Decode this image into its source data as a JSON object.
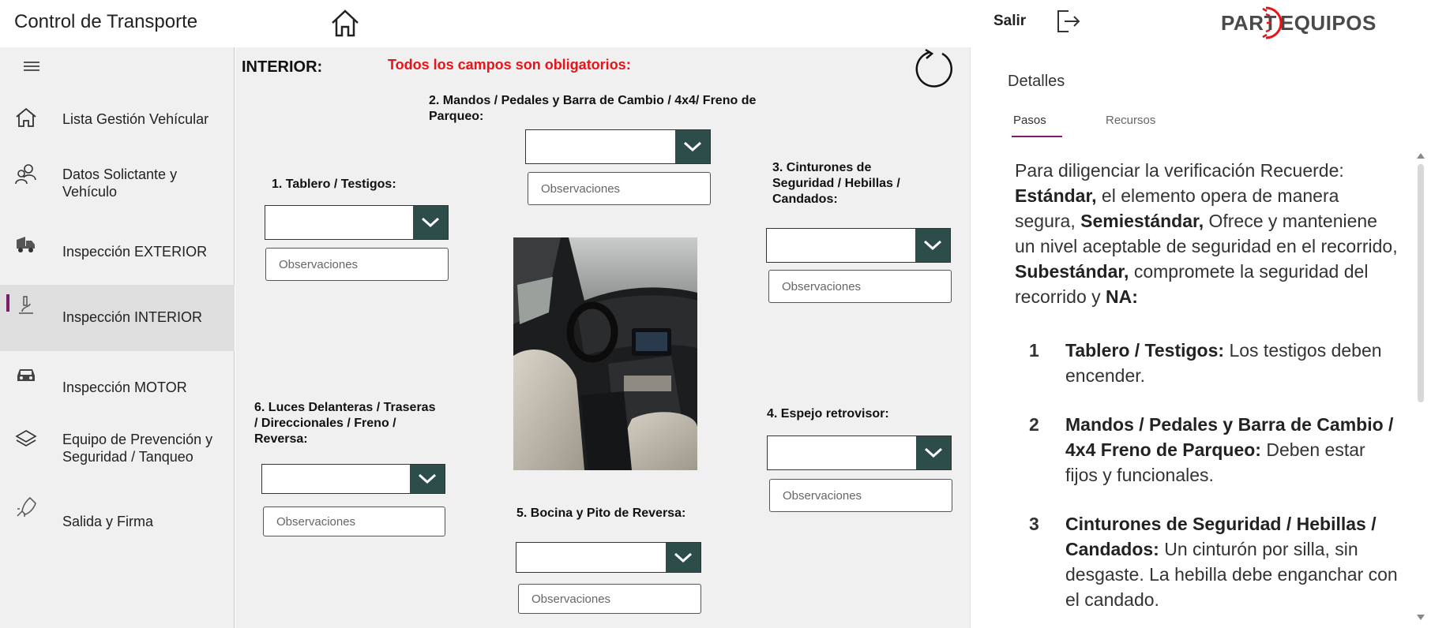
{
  "header": {
    "app_title": "Control de Transporte",
    "exit_label": "Salir",
    "brand_left": "PART",
    "brand_right": "EQUIPOS"
  },
  "sidebar": {
    "items": [
      {
        "label": "Lista  Gestión Vehícular",
        "icon": "home-icon"
      },
      {
        "label": "Datos Solictante y Vehículo",
        "icon": "people-icon"
      },
      {
        "label": "Inspección EXTERIOR",
        "icon": "truck-icon"
      },
      {
        "label": "Inspección INTERIOR",
        "icon": "microscope-icon",
        "active": true
      },
      {
        "label": "Inspección MOTOR",
        "icon": "car-icon"
      },
      {
        "label": "Equipo de Prevención y Seguridad / Tanqueo",
        "icon": "layers-icon"
      },
      {
        "label": "Salida y Firma",
        "icon": "rocket-icon"
      }
    ]
  },
  "main": {
    "section_title": "INTERIOR:",
    "required_note": "Todos los campos son obligatorios:",
    "observation_placeholder": "Observaciones",
    "fields": [
      {
        "label": "1. Tablero / Testigos:"
      },
      {
        "label": "2. Mandos / Pedales y Barra de Cambio / 4x4/ Freno de Parqueo:"
      },
      {
        "label": "3. Cinturones de Seguridad / Hebillas / Candados:"
      },
      {
        "label": "4. Espejo retrovisor:"
      },
      {
        "label": "5. Bocina y Pito de Reversa:"
      },
      {
        "label": "6. Luces Delanteras / Traseras / Direccionales / Freno / Reversa:"
      }
    ]
  },
  "details": {
    "title": "Detalles",
    "tabs": [
      "Pasos",
      "Recursos"
    ],
    "intro": {
      "p1": "Para diligenciar la verificación Recuerde: ",
      "b1": "Estándar,",
      "p2": " el elemento opera de manera segura, ",
      "b2": "Semiestándar,",
      "p3": " Ofrece y manteniene un nivel aceptable de seguridad en el recorrido, ",
      "b3": "Subestándar,",
      "p4": " compromete la seguridad del recorrido y ",
      "b4": "NA:"
    },
    "steps": [
      {
        "num": "1",
        "title": "Tablero / Testigos:",
        "text": " Los testigos deben encender."
      },
      {
        "num": "2",
        "title": "Mandos / Pedales y Barra de Cambio / 4x4 Freno de Parqueo:",
        "text": " Deben estar fijos y funcionales."
      },
      {
        "num": "3",
        "title": "Cinturones de Seguridad / Hebillas / Candados:",
        "text": " Un cinturón por silla, sin desgaste. La hebilla debe enganchar con el candado."
      }
    ]
  },
  "colors": {
    "accent": "#7a1d6b",
    "dropdown_button": "#2d4d4a",
    "required": "#e8141a"
  }
}
